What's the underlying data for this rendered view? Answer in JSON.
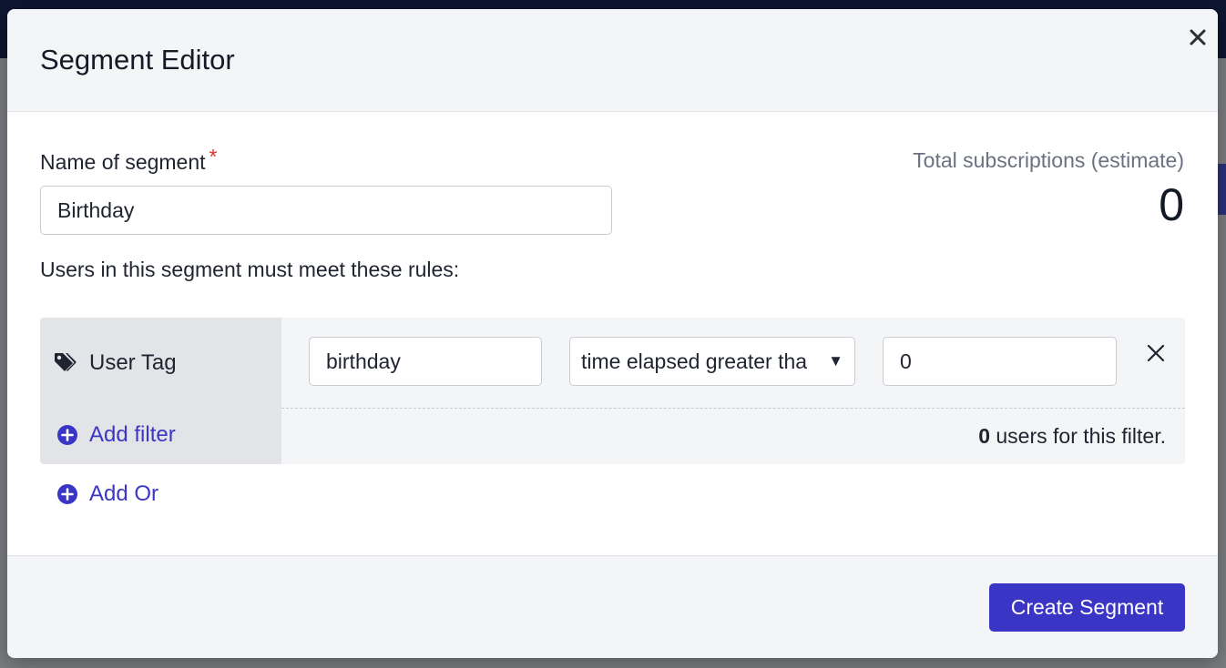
{
  "modal": {
    "title": "Segment Editor"
  },
  "form": {
    "name_label": "Name of segment",
    "required_marker": "*",
    "name_value": "Birthday",
    "estimate_label": "Total subscriptions (estimate)",
    "estimate_value": "0",
    "rules_label": "Users in this segment must meet these rules:"
  },
  "rule": {
    "type_label": "User Tag",
    "tag_value": "birthday",
    "operator_value": "time elapsed greater tha",
    "value": "0",
    "add_filter_label": "Add filter",
    "users_count": "0",
    "users_count_suffix": " users for this filter."
  },
  "add_or_label": "Add Or",
  "footer": {
    "create_label": "Create Segment"
  },
  "icons": {
    "close": "close-icon",
    "tag": "tag-icon",
    "remove": "close-icon",
    "add": "plus-circle-icon",
    "caret": "caret-down-icon"
  },
  "colors": {
    "accent": "#3a35c4",
    "link": "#3b36c4",
    "required": "#e03131",
    "header_bg": "#f4f5f7",
    "rule_left_bg": "#e2e4e8"
  }
}
